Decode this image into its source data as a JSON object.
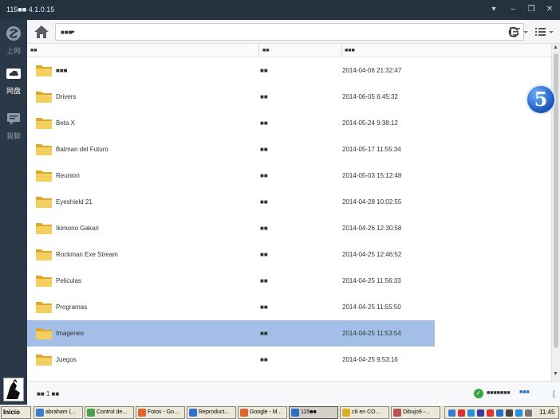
{
  "window": {
    "title": "115■■ 4.1.0.15",
    "minimize_label": "▾",
    "restore_label": "–",
    "maximize_label": "❐",
    "close_label": "✕"
  },
  "sidebar": {
    "items": [
      {
        "label": "上网",
        "icon": "swirl-icon"
      },
      {
        "label": "网盘",
        "icon": "cloud-icon"
      },
      {
        "label": "我聊",
        "icon": "chat-icon"
      }
    ]
  },
  "toolbar": {
    "breadcrumb": "■■■",
    "breadcrumb_caret": "▸"
  },
  "columns": {
    "name": "■■",
    "type": "■■",
    "date": "■■■"
  },
  "files": [
    {
      "name": "■■■",
      "type": "■■",
      "date": "2014-04-06 21:32:47"
    },
    {
      "name": "Drivers",
      "type": "■■",
      "date": "2014-06-05 6:45:32"
    },
    {
      "name": "Beta X",
      "type": "■■",
      "date": "2014-05-24 9:38:12"
    },
    {
      "name": "Batman del Futuro",
      "type": "■■",
      "date": "2014-05-17 11:55:34"
    },
    {
      "name": "Reunion",
      "type": "■■",
      "date": "2014-05-03 15:12:48"
    },
    {
      "name": "Eyeshield 21",
      "type": "■■",
      "date": "2014-04-28 10:02:55"
    },
    {
      "name": "Ikimono Gakari",
      "type": "■■",
      "date": "2014-04-26 12:30:58"
    },
    {
      "name": "Rockman Exe Stream",
      "type": "■■",
      "date": "2014-04-25 12:46:52"
    },
    {
      "name": "Peliculas",
      "type": "■■",
      "date": "2014-04-25 11:56:33"
    },
    {
      "name": "Programas",
      "type": "■■",
      "date": "2014-04-25 11:55:50"
    },
    {
      "name": "Imagenes",
      "type": "■■",
      "date": "2014-04-25 11:53:54",
      "selected": true
    },
    {
      "name": "Juegos",
      "type": "■■",
      "date": "2014-04-25 9:53:16"
    },
    {
      "name": "",
      "type": "",
      "date": ""
    }
  ],
  "status": {
    "count": "■■ 1 ■■",
    "ok_text": "■■■■■■■",
    "link": "■■■",
    "bracket": "["
  },
  "badge": {
    "number": "5"
  },
  "taskbar": {
    "start": "Inicio",
    "tasks": [
      {
        "label": "abraham (...",
        "color": "#3a7bd5"
      },
      {
        "label": "Control de...",
        "color": "#4aa04a"
      },
      {
        "label": "Fotos - Go...",
        "color": "#e0662a"
      },
      {
        "label": "Reproduct...",
        "color": "#2f6fd0"
      },
      {
        "label": "Google - M...",
        "color": "#e0662a"
      },
      {
        "label": "115■■",
        "color": "#2b6fc7",
        "active": true
      },
      {
        "label": "c8 en CO...",
        "color": "#d8b020"
      },
      {
        "label": "Dibujo9 -...",
        "color": "#c05050"
      }
    ],
    "clock": "11:45"
  },
  "colors": {
    "selected_row": "#a3bfe8",
    "sidebar": "#2b3848",
    "folder": "#f2c14e"
  }
}
